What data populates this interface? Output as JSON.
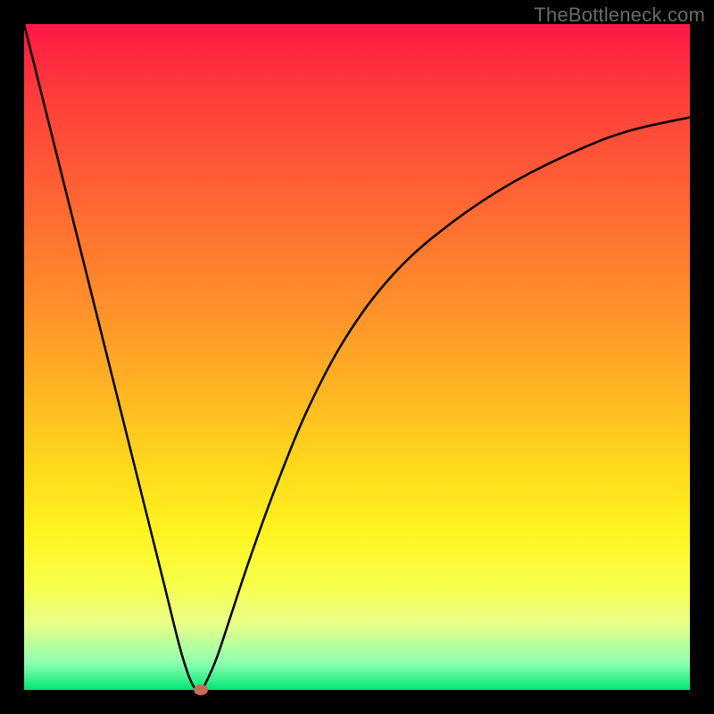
{
  "watermark": "TheBottleneck.com",
  "colors": {
    "background": "#000000",
    "gradient_top": "#ff1744",
    "gradient_bottom": "#00e676",
    "curve": "#000000",
    "dot": "#c96b5a",
    "watermark_text": "#6b6b6b"
  },
  "chart_data": {
    "type": "line",
    "title": "",
    "xlabel": "",
    "ylabel": "",
    "xlim": [
      0,
      100
    ],
    "ylim": [
      0,
      100
    ],
    "grid": false,
    "series": [
      {
        "name": "bottleneck-curve",
        "x": [
          0,
          3,
          6,
          9,
          12,
          15,
          18,
          21,
          23.5,
          25.2,
          26.5,
          27.5,
          29,
          31,
          34,
          38,
          43,
          49,
          56,
          64,
          73,
          83,
          91,
          100
        ],
        "values": [
          100,
          88,
          76,
          64,
          52,
          40,
          28,
          16,
          6,
          1,
          0,
          1.5,
          5,
          11,
          20,
          31,
          43,
          54,
          63,
          70,
          76,
          81,
          84,
          86
        ]
      }
    ],
    "annotations": [
      {
        "type": "point",
        "name": "minimum-dot",
        "x": 26.5,
        "y": 0
      }
    ]
  }
}
